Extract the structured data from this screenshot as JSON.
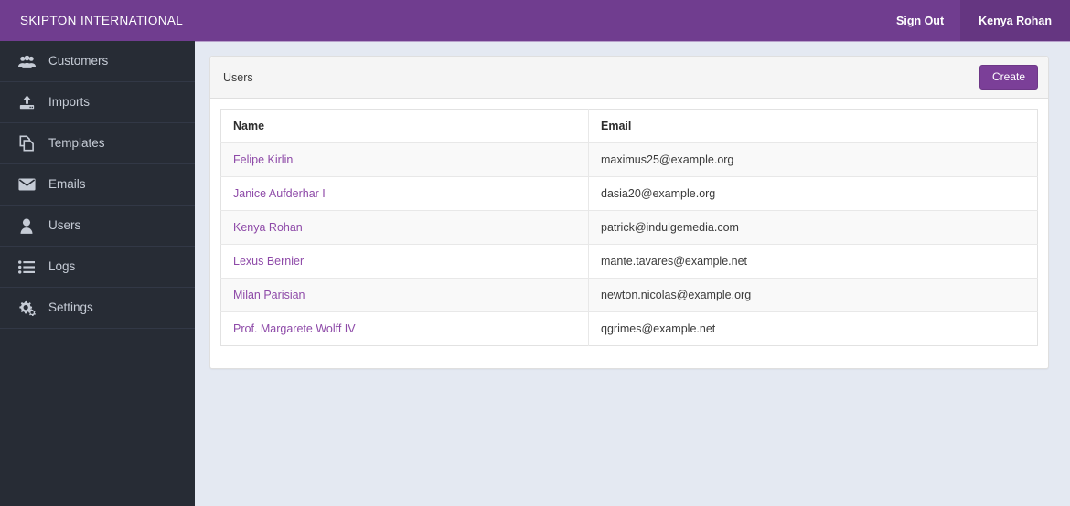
{
  "topbar": {
    "brand": "SKIPTON INTERNATIONAL",
    "sign_out_label": "Sign Out",
    "user_name": "Kenya Rohan",
    "background_color": "#703d8f",
    "user_background_color": "#653681"
  },
  "sidebar": {
    "background_color": "#272c35",
    "items": [
      {
        "label": "Customers",
        "icon": "users-group-icon"
      },
      {
        "label": "Imports",
        "icon": "upload-icon"
      },
      {
        "label": "Templates",
        "icon": "copy-documents-icon"
      },
      {
        "label": "Emails",
        "icon": "envelope-icon"
      },
      {
        "label": "Users",
        "icon": "user-icon"
      },
      {
        "label": "Logs",
        "icon": "list-icon"
      },
      {
        "label": "Settings",
        "icon": "cogs-icon"
      }
    ]
  },
  "panel": {
    "title": "Users",
    "create_label": "Create",
    "create_color": "#7b3f98"
  },
  "table": {
    "columns": [
      "Name",
      "Email"
    ],
    "rows": [
      {
        "name": "Felipe Kirlin",
        "email": "maximus25@example.org"
      },
      {
        "name": "Janice Aufderhar I",
        "email": "dasia20@example.org"
      },
      {
        "name": "Kenya Rohan",
        "email": "patrick@indulgemedia.com"
      },
      {
        "name": "Lexus Bernier",
        "email": "mante.tavares@example.net"
      },
      {
        "name": "Milan Parisian",
        "email": "newton.nicolas@example.org"
      },
      {
        "name": "Prof. Margarete Wolff IV",
        "email": "qgrimes@example.net"
      }
    ],
    "link_color": "#8e4aa8"
  }
}
